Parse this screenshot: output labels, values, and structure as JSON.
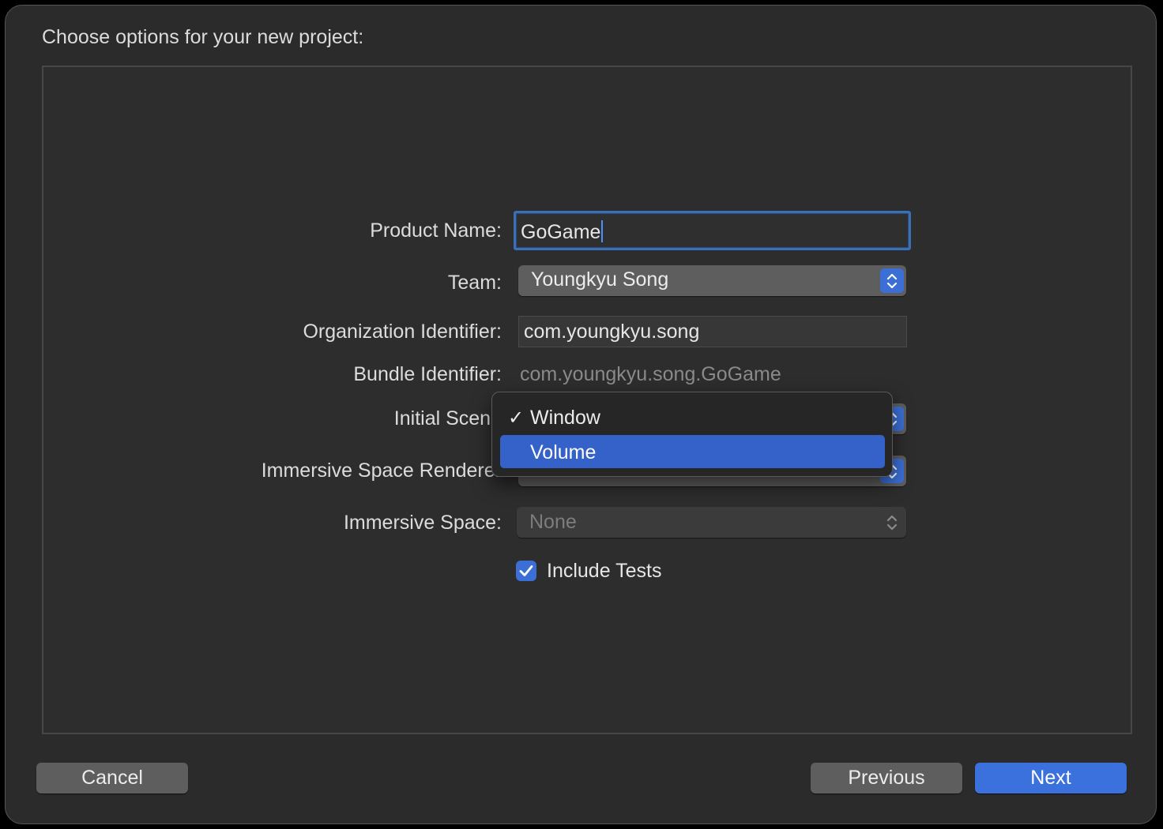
{
  "dialog": {
    "heading": "Choose options for your new project:"
  },
  "form": {
    "product_name": {
      "label": "Product Name:",
      "value": "GoGame"
    },
    "team": {
      "label": "Team:",
      "value": "Youngkyu Song"
    },
    "organization_identifier": {
      "label": "Organization Identifier:",
      "value": "com.youngkyu.song"
    },
    "bundle_identifier": {
      "label": "Bundle Identifier:",
      "value": "com.youngkyu.song.GoGame"
    },
    "initial_scene": {
      "label": "Initial Scene"
    },
    "immersive_space_renderer": {
      "label": "Immersive Space Renderer"
    },
    "immersive_space": {
      "label": "Immersive Space:",
      "value": "None"
    },
    "include_tests": {
      "label": "Include Tests",
      "checked": true
    }
  },
  "scene_menu": {
    "items": [
      {
        "label": "Window",
        "checked": true,
        "highlighted": false
      },
      {
        "label": "Volume",
        "checked": false,
        "highlighted": true
      }
    ],
    "check_glyph": "✓"
  },
  "buttons": {
    "cancel": "Cancel",
    "previous": "Previous",
    "next": "Next"
  },
  "colors": {
    "accent": "#3b71dc",
    "menu_highlight": "#3462c9",
    "window_bg": "#2b2b2b"
  },
  "icons": {
    "popup_arrows": "chevron-up-down-icon",
    "checkbox": "checkmark-icon"
  }
}
